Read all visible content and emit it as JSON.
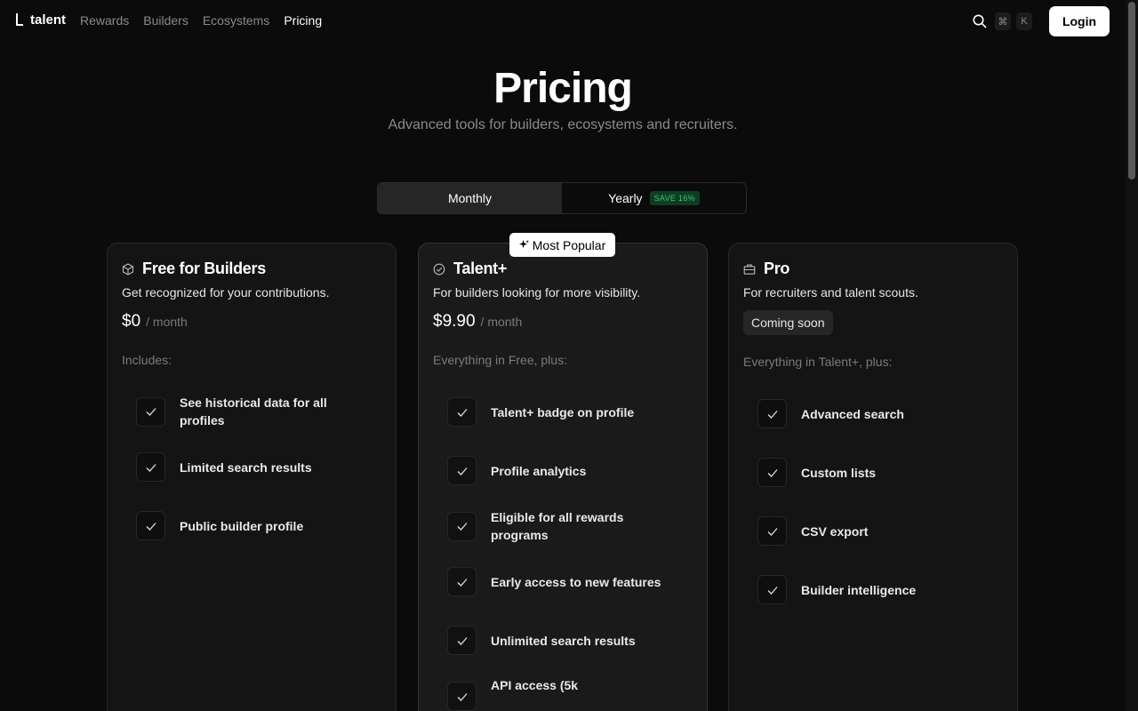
{
  "nav": {
    "logo": "talent",
    "links": [
      {
        "label": "Rewards",
        "active": false
      },
      {
        "label": "Builders",
        "active": false
      },
      {
        "label": "Ecosystems",
        "active": false
      },
      {
        "label": "Pricing",
        "active": true
      }
    ],
    "shortcut_keys": [
      "⌘",
      "K"
    ],
    "login_label": "Login"
  },
  "hero": {
    "title": "Pricing",
    "subtitle": "Advanced tools for builders, ecosystems and recruiters."
  },
  "billing_toggle": {
    "monthly": "Monthly",
    "yearly": "Yearly",
    "save_badge": "SAVE 16%",
    "selected": "monthly"
  },
  "popular_badge": "Most Popular",
  "plans": [
    {
      "icon": "cube-icon",
      "title": "Free for Builders",
      "description": "Get recognized for your contributions.",
      "price": "$0",
      "period": "/ month",
      "includes": "Includes:",
      "features": [
        "See historical data for all profiles",
        "Limited search results",
        "Public builder profile"
      ]
    },
    {
      "icon": "verified-badge-icon",
      "title": "Talent+",
      "description": "For builders looking for more visibility.",
      "price": "$9.90",
      "period": "/ month",
      "includes": "Everything in Free, plus:",
      "features": [
        "Talent+ badge on profile",
        "Profile analytics",
        "Eligible for all rewards programs",
        "Early access to new features",
        "Unlimited search results",
        "API access (5k"
      ]
    },
    {
      "icon": "briefcase-icon",
      "title": "Pro",
      "description": "For recruiters and talent scouts.",
      "status": "Coming soon",
      "includes": "Everything in Talent+, plus:",
      "features": [
        "Advanced search",
        "Custom lists",
        "CSV export",
        "Builder intelligence"
      ]
    }
  ],
  "colors": {
    "background": "#0b0b0b",
    "card": "#141414",
    "card_highlight": "#1a1a1a",
    "muted_text": "#8a8a8a",
    "save_green": "#34c77b"
  }
}
